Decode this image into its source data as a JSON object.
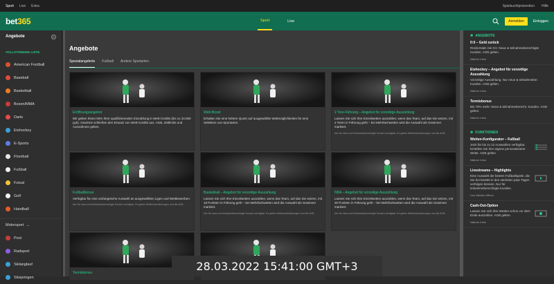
{
  "topbar": {
    "items": [
      "Sport",
      "Live",
      "Extra"
    ],
    "right": [
      "Spielsuchtprävention",
      "Hilfe"
    ]
  },
  "header": {
    "logo_main": "bet",
    "logo_accent": "365",
    "nav": [
      "Sport",
      "Live"
    ],
    "join_label": "Anmelden",
    "login_label": "Einloggen"
  },
  "sidebar": {
    "title": "Angebote",
    "section": "VOLLSTÄNDIGE LISTE",
    "items": [
      {
        "label": "American Football",
        "color": "#d8532e"
      },
      {
        "label": "Baseball",
        "color": "#e04a3f"
      },
      {
        "label": "Basketball",
        "color": "#f07a28"
      },
      {
        "label": "Boxen/MMA",
        "color": "#cc3b3b"
      },
      {
        "label": "Darts",
        "color": "#e64a4a"
      },
      {
        "label": "Eishockey",
        "color": "#3aa0d8"
      },
      {
        "label": "E-Sports",
        "color": "#5e7de0"
      },
      {
        "label": "Floorball",
        "color": "#e6e6e6"
      },
      {
        "label": "Fußball",
        "color": "#f2f2f2"
      },
      {
        "label": "Futsal",
        "color": "#f0c23a"
      },
      {
        "label": "Golf",
        "color": "#f2f2f2"
      },
      {
        "label": "Handball",
        "color": "#e85c2a"
      }
    ],
    "motorsport": "Motorsport",
    "items2": [
      {
        "label": "Pool",
        "color": "#c73c3c"
      },
      {
        "label": "Radsport",
        "color": "#8b5fe0"
      },
      {
        "label": "Skilanglauf",
        "color": "#3aa0d8"
      },
      {
        "label": "Skispringen",
        "color": "#3aa0d8"
      }
    ]
  },
  "main": {
    "title": "Angebote",
    "tabs": [
      "Spezialangebote",
      "Fußball",
      "Andere Sportarten"
    ],
    "cards": [
      {
        "title": "Eröffnungsangebot",
        "text": "Wir geben Ihnen 50% Ihrer qualifizierenden Einzahlung in Wett-Credits (bis zu 10.000 pyb). Gewinne schließen den Einsatz von Wett-Credits aus. AGB, Zeitlimits und Ausnahmen gelten.",
        "foot": ""
      },
      {
        "title": "Wett-Boost",
        "text": "Erhalten Sie eine höhere Quote auf ausgewählte Wettmöglichkeiten für eine Selektion von Sportarten.",
        "foot": ""
      },
      {
        "title": "2 Tore-Führung – Angebot für vorzeitige Auszahlung",
        "text": "Lassen Sie sich Ihre Einzelwetten auszahlen, wenn das Team, auf das Sie setzen, mit 2 Toren in Führung geht – bei Mehrfachwetten wird die Auswahl als Gewinner markiert.",
        "foot": "Nur für neue und teilnahmeberechtigte Kunden verfügbar. Es gelten Wettenschränkungen und die AGB."
      },
      {
        "title": "Fußballbonus",
        "text": "Verfügbar für eine umfangreiche Auswahl an ausgewählten Ligen und Wettbewerben.",
        "foot": "Nur für neue und teilnahmeberechtigte Kunden verfügbar. Es gelten Wettenschränkungen und die AGB."
      },
      {
        "title": "Basketball – Angebot für vorzeitige Auszahlung",
        "text": "Lassen Sie sich Ihre Einzelwetten auszahlen, wenn das Team, auf das Sie setzen, mit 18 Punkten in Führung geht – bei Mehrfachwetten wird die Auswahl als Gewinner markiert.",
        "foot": "Nur für neue und teilnahmeberechtigte Kunden verfügbar. Es gelten Wettenschränkungen und die AGB."
      },
      {
        "title": "NBA – Angebot für vorzeitige Auszahlung",
        "text": "Lassen Sie sich Ihre Einzelwetten auszahlen, wenn das Team, auf das Sie setzen, mit 20 Punkten in Führung geht – bei Mehrfachwetten wird die Auswahl als Gewinner markiert.",
        "foot": "Nur für neue und teilnahmeberechtigte Kunden verfügbar. Es gelten Wettenschränkungen und die AGB."
      },
      {
        "title": "Tennisbonus",
        "text": "",
        "foot": ""
      },
      {
        "title": "",
        "text": "",
        "foot": ""
      }
    ]
  },
  "right": {
    "sec1": "ANGEBOTE",
    "offers": [
      {
        "title": "0:0 – Geld zurück",
        "desc": "Rückerstatt. bei 0:0. Neue & teilnahmeberechtigte Kunden. AGB gelten.",
        "more": "Nähere Infos"
      },
      {
        "title": "Eishockey – Angebot für vorzeitige Auszahlung",
        "desc": "Vorzeitige Auszahlung. Nur neue & teilnahmeber. Kunden. AGB gelten.",
        "more": "Nähere Infos"
      },
      {
        "title": "Tennisbonus",
        "desc": "Bis 70% mehr. Neue & teilnahmeberecht. Kunden. AGB gelten.",
        "more": "Nähere Infos"
      }
    ],
    "sec2": "FUNKTIONEN",
    "features": [
      {
        "title": "Wetten-Konfigurator – Fußball",
        "desc": "Jetzt für bis zu 12 Auswahlen verfügbar. Erstellen Sie Ihre eigene personalisierte Wette. AGB gelten.",
        "more": "Nähere Infos"
      },
      {
        "title": "Livestreams – Highlights",
        "desc": "Eine Auswahl der besten Fußballspiele, die Sie bei bet365 in den nächsten paar Tagen verfolgen können. Nur für teilnahmeberechtigte Kunden.",
        "more": "Live-Medien öffnen"
      },
      {
        "title": "Cash-Out-Option",
        "desc": "Lassen Sie sich Ihre Wetten schon vor dem Ende auszahlen. AGB gelten.",
        "more": "Nähere Infos"
      }
    ]
  },
  "timestamp": "28.03.2022   15:41:00   GMT+3"
}
